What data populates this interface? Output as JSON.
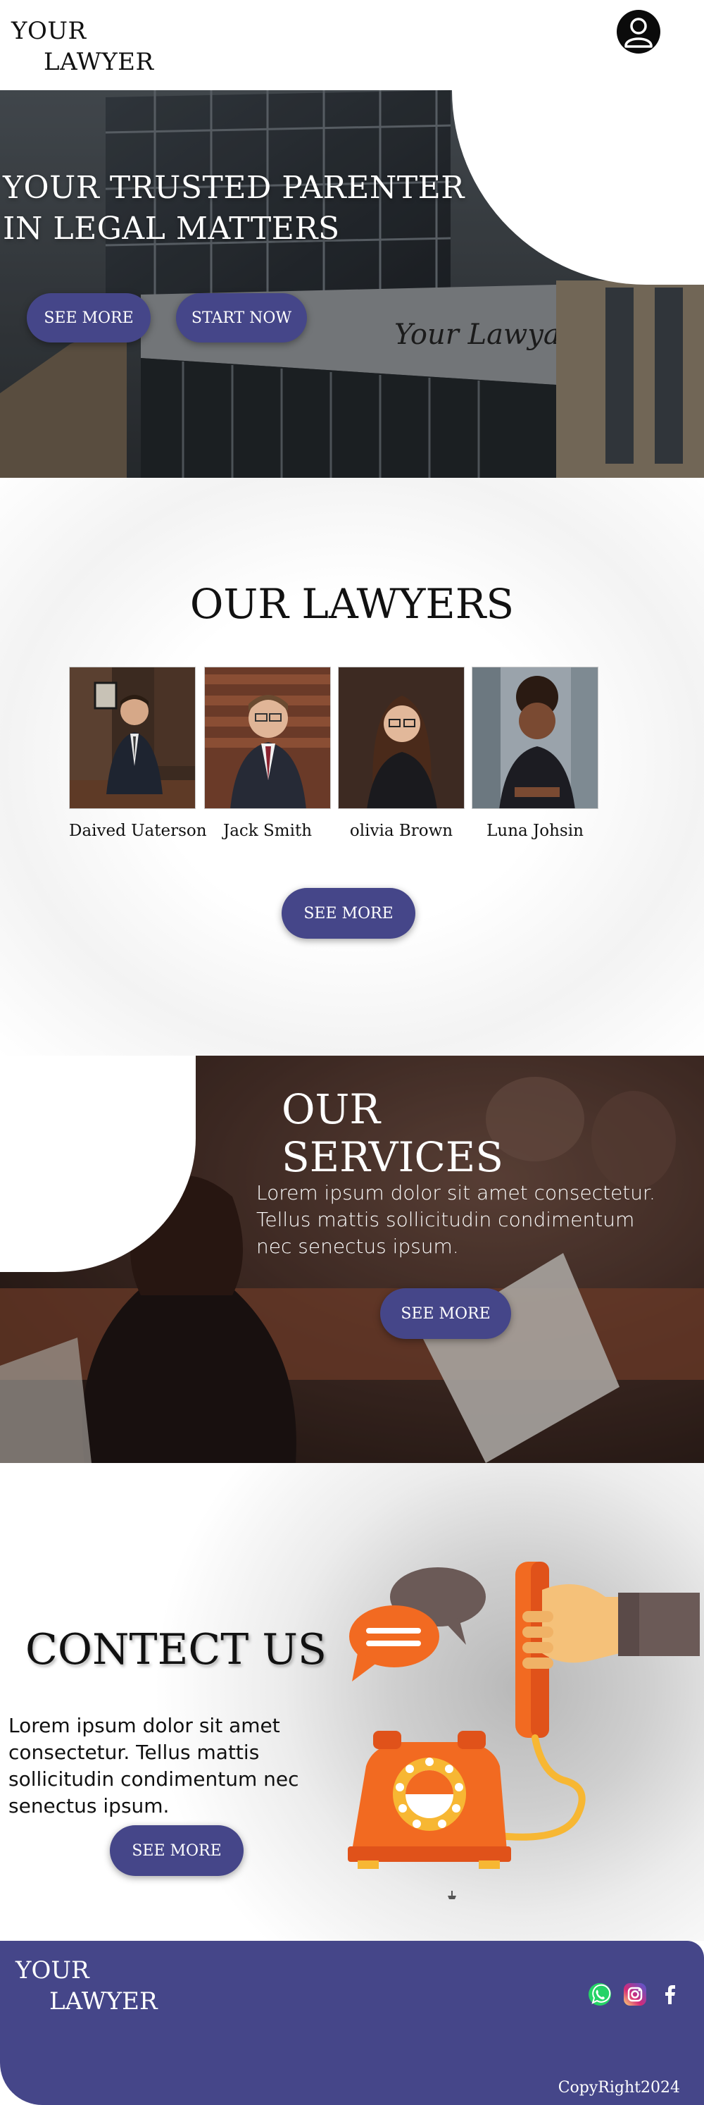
{
  "header": {
    "logo_line1": "YOUR",
    "logo_line2": "LAWYER",
    "profile_icon": "user-circle-icon"
  },
  "hero": {
    "title_line1": "YOUR TRUSTED PARENTER",
    "title_line2": "IN LEGAL MATTERS",
    "building_sign": "Your Lawyar",
    "see_more_label": "SEE MORE",
    "start_now_label": "START NOW"
  },
  "lawyers": {
    "title": "OUR LAWYERS",
    "people": [
      {
        "name": "Daived Uaterson"
      },
      {
        "name": "Jack Smith"
      },
      {
        "name": "olivia Brown"
      },
      {
        "name": "Luna Johsin"
      }
    ],
    "see_more_label": "SEE MORE"
  },
  "services": {
    "title": "OUR SERVICES",
    "text": "Lorem ipsum dolor sit amet consectetur. Tellus mattis sollicitudin condimentum nec senectus ipsum.",
    "see_more_label": "SEE MORE"
  },
  "contact": {
    "title": "CONTECT US",
    "text": "Lorem ipsum dolor sit amet consectetur. Tellus mattis sollicitudin condimentum nec senectus ipsum.",
    "see_more_label": "SEE MORE",
    "illustration": "telephone-call-illustration"
  },
  "footer": {
    "logo_line1": "YOUR",
    "logo_line2": "LAWYER",
    "social": [
      "whatsapp-icon",
      "instagram-icon",
      "facebook-icon"
    ],
    "copyright": "CopyRight2024"
  },
  "colors": {
    "primary": "#454689",
    "white": "#ffffff",
    "text": "#111111",
    "phone_orange": "#f26a21",
    "phone_yellow": "#f7b733"
  }
}
